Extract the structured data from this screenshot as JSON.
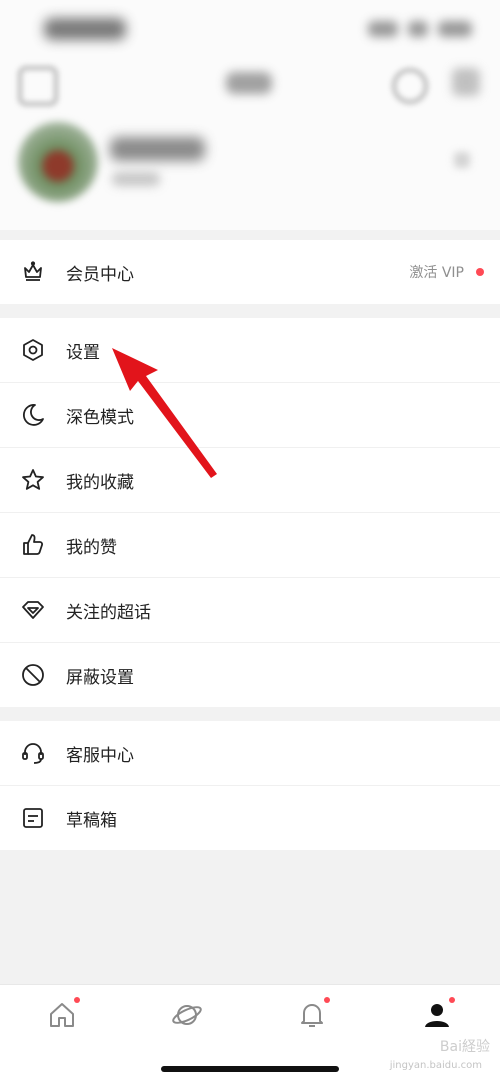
{
  "menu": {
    "vip": {
      "label": "会员中心",
      "action_text": "激活 VIP"
    },
    "main": [
      {
        "label": "设置",
        "icon": "hexagon-settings-icon"
      },
      {
        "label": "深色模式",
        "icon": "moon-icon"
      },
      {
        "label": "我的收藏",
        "icon": "star-icon"
      },
      {
        "label": "我的赞",
        "icon": "thumbs-up-icon"
      },
      {
        "label": "关注的超话",
        "icon": "diamond-icon"
      },
      {
        "label": "屏蔽设置",
        "icon": "block-icon"
      }
    ],
    "support": [
      {
        "label": "客服中心",
        "icon": "headset-icon"
      },
      {
        "label": "草稿箱",
        "icon": "draft-box-icon"
      }
    ]
  },
  "tabbar": [
    {
      "name": "home",
      "icon": "home-icon",
      "badge": true,
      "active": false
    },
    {
      "name": "discover",
      "icon": "planet-icon",
      "badge": false,
      "active": false
    },
    {
      "name": "notifications",
      "icon": "bell-icon",
      "badge": true,
      "active": false
    },
    {
      "name": "profile",
      "icon": "person-icon",
      "badge": true,
      "active": true
    }
  ],
  "watermark": {
    "text": "Bai経验",
    "sub": "jingyan.baidu.com"
  },
  "colors": {
    "accent_red": "#ff4a55",
    "arrow_red": "#e2141b",
    "text": "#222222",
    "muted": "#8f8f8f"
  }
}
